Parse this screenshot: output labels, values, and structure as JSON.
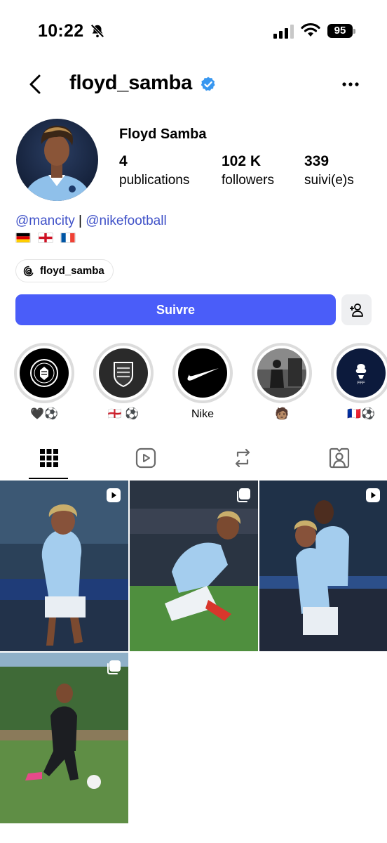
{
  "status_bar": {
    "time": "10:22",
    "battery": "95"
  },
  "header": {
    "username": "floyd_samba"
  },
  "profile": {
    "full_name": "Floyd Samba",
    "stats": [
      {
        "value": "4",
        "label": "publications"
      },
      {
        "value": "102 K",
        "label": "followers"
      },
      {
        "value": "339",
        "label": "suivi(e)s"
      }
    ],
    "bio_links": [
      "@mancity",
      "|",
      "@nikefootball"
    ],
    "flags": [
      "germany",
      "england",
      "france"
    ],
    "threads_handle": "floyd_samba"
  },
  "actions": {
    "follow_label": "Suivre"
  },
  "highlights": [
    {
      "label": "🖤⚽️",
      "icon": "man-city-crest"
    },
    {
      "label": "🏴󠁧󠁢󠁥󠁮󠁧󠁿 ⚽️",
      "icon": "england-crest"
    },
    {
      "label": "Nike",
      "icon": "nike-swoosh"
    },
    {
      "label": "🧑🏽",
      "icon": "photo"
    },
    {
      "label": "🇫🇷⚽️",
      "icon": "fff-crest"
    }
  ],
  "tabs": [
    "grid",
    "reels",
    "reposts",
    "tagged"
  ],
  "posts": [
    {
      "type": "reel"
    },
    {
      "type": "carousel"
    },
    {
      "type": "reel"
    },
    {
      "type": "carousel"
    }
  ],
  "colors": {
    "accent": "#4a5df9",
    "link": "#3f51c8",
    "verified": "#3897f0",
    "city_blue": "#9fc9ec"
  }
}
